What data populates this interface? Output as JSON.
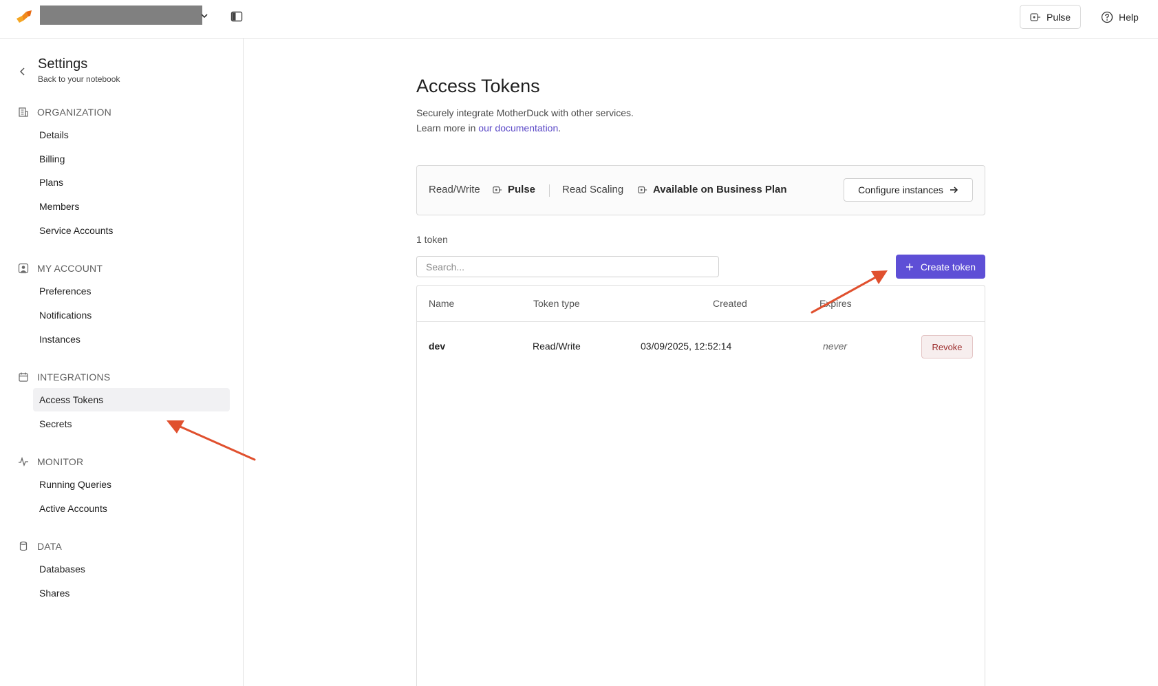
{
  "topbar": {
    "pulse_label": "Pulse",
    "help_label": "Help"
  },
  "sidebar": {
    "title": "Settings",
    "subtitle": "Back to your notebook",
    "sections": {
      "organization": {
        "heading": "ORGANIZATION",
        "items": [
          "Details",
          "Billing",
          "Plans",
          "Members",
          "Service Accounts"
        ]
      },
      "my_account": {
        "heading": "MY ACCOUNT",
        "items": [
          "Preferences",
          "Notifications",
          "Instances"
        ]
      },
      "integrations": {
        "heading": "INTEGRATIONS",
        "items": [
          "Access Tokens",
          "Secrets"
        ],
        "active": "Access Tokens"
      },
      "monitor": {
        "heading": "MONITOR",
        "items": [
          "Running Queries",
          "Active Accounts"
        ]
      },
      "data": {
        "heading": "DATA",
        "items": [
          "Databases",
          "Shares"
        ]
      }
    }
  },
  "main": {
    "title": "Access Tokens",
    "description_line1": "Securely integrate MotherDuck with other services.",
    "description_line2_prefix": "Learn more in ",
    "description_link": "our documentation",
    "description_line2_suffix": ".",
    "instances": {
      "rw_label": "Read/Write",
      "rw_value": "Pulse",
      "rs_label": "Read Scaling",
      "rs_value": "Available on Business Plan",
      "configure_label": "Configure instances"
    },
    "token_count": "1 token",
    "search_placeholder": "Search...",
    "create_label": "Create token",
    "table": {
      "headers": [
        "Name",
        "Token type",
        "Created",
        "Expires"
      ],
      "rows": [
        {
          "name": "dev",
          "type": "Read/Write",
          "created": "03/09/2025, 12:52:14",
          "expires": "never",
          "action": "Revoke"
        }
      ]
    }
  },
  "colors": {
    "accent": "#5e4fd6",
    "link": "#5a48c7",
    "annotation": "#e0502e",
    "revoke_text": "#9c2b2b"
  }
}
